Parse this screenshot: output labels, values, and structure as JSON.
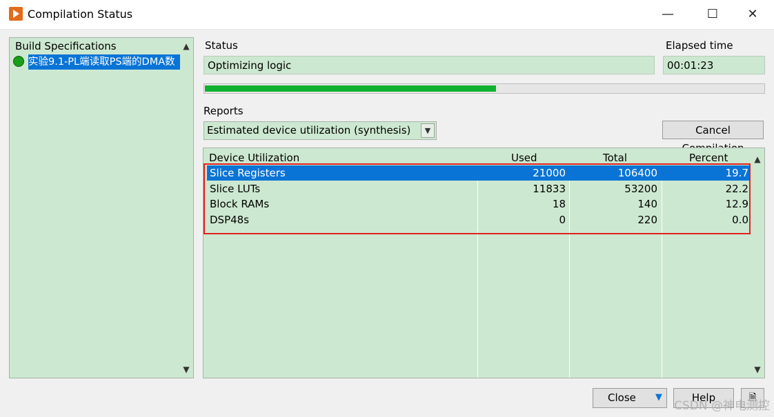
{
  "window": {
    "title": "Compilation Status",
    "minimize": "—",
    "maximize": "☐",
    "close": "✕"
  },
  "build_specs": {
    "header": "Build Specifications",
    "items": [
      {
        "label": "实验9.1-PL端读取PS端的DMA数",
        "status_color": "#1a9e1a"
      }
    ]
  },
  "status": {
    "label": "Status",
    "value": "Optimizing logic"
  },
  "elapsed": {
    "label": "Elapsed time",
    "value": "00:01:23"
  },
  "progress": {
    "fraction": 0.52
  },
  "reports": {
    "label": "Reports",
    "selected": "Estimated device utilization (synthesis)"
  },
  "buttons": {
    "cancel": "Cancel Compilation",
    "close": "Close",
    "help": "Help"
  },
  "table": {
    "headers": [
      "Device Utilization",
      "Used",
      "Total",
      "Percent"
    ],
    "rows": [
      [
        "Slice Registers",
        "21000",
        "106400",
        "19.7"
      ],
      [
        "Slice LUTs",
        "11833",
        "53200",
        "22.2"
      ],
      [
        "Block RAMs",
        "18",
        "140",
        "12.9"
      ],
      [
        "DSP48s",
        "0",
        "220",
        "0.0"
      ]
    ],
    "selected_row": 0
  },
  "watermark": "CSDN @神电测控",
  "colors": {
    "panel_green": "#cde8d0",
    "selection_blue": "#0a74d6",
    "progress_green": "#10b030",
    "highlight_red": "#e02020"
  }
}
